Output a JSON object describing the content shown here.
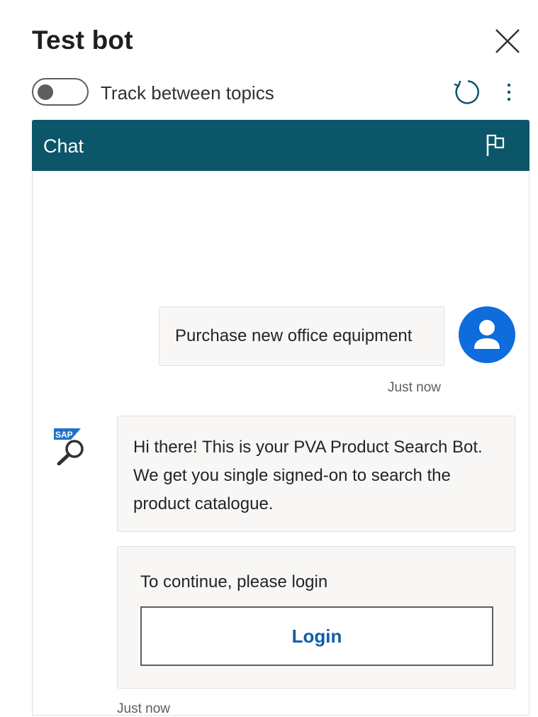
{
  "header": {
    "title": "Test bot",
    "close_icon": "close-icon"
  },
  "toolbar": {
    "toggle_label": "Track between topics",
    "toggle_on": false,
    "refresh_icon": "refresh-icon",
    "more_icon": "more-vertical-icon"
  },
  "chat": {
    "title": "Chat",
    "flag_icon": "flag-icon",
    "header_color": "#0b5669",
    "messages": [
      {
        "from": "user",
        "text": "Purchase new office equipment",
        "timestamp": "Just now",
        "avatar_color": "#0f6cdc"
      },
      {
        "from": "bot",
        "text": "Hi there! This is your PVA Product Search Bot. We get you single signed-on to search the product catalogue.",
        "avatar_logo": "SAP"
      },
      {
        "from": "bot",
        "card_text": "To continue, please login",
        "button_label": "Login",
        "timestamp": "Just now"
      }
    ]
  }
}
